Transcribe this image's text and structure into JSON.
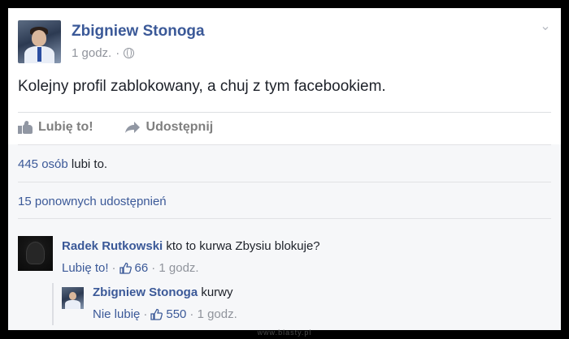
{
  "post": {
    "author": "Zbigniew Stonoga",
    "time": "1 godz.",
    "separator": "·",
    "text": "Kolejny profil zablokowany, a chuj z tym facebookiem."
  },
  "actions": {
    "like_label": "Lubię to!",
    "share_label": "Udostępnij"
  },
  "footer": {
    "likes_link": "445 osób",
    "likes_rest": " lubi to.",
    "shares": "15 ponownych udostępnień"
  },
  "comments": [
    {
      "author": "Radek Rutkowski",
      "text": " kto to kurwa Zbysiu blokuje?",
      "action": "Lubię to!",
      "sep": "·",
      "likes": "66",
      "time": "· 1 godz."
    },
    {
      "author": "Zbigniew Stonoga",
      "text": " kurwy",
      "action": "Nie lubię",
      "sep": "·",
      "likes": "550",
      "time": "· 1 godz."
    }
  ],
  "watermark": "www.blasty.pl",
  "colors": {
    "link": "#3b5998",
    "muted": "#90949c",
    "text": "#1d2129",
    "footer_bg": "#f6f7f9"
  },
  "icons": [
    "globe-icon",
    "chevron-down-icon",
    "like-thumb-icon",
    "share-arrow-icon"
  ]
}
